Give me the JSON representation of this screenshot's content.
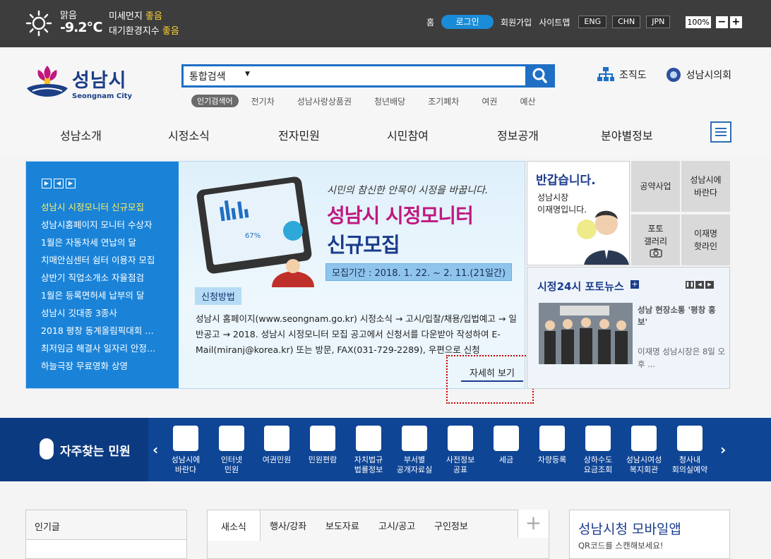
{
  "weather": {
    "condition": "맑음",
    "temp": "-9.2℃",
    "dust_label": "미세먼지",
    "dust_value": "좋음",
    "air_label": "대기환경지수",
    "air_value": "좋음"
  },
  "toplinks": {
    "home": "홈",
    "login": "로그인",
    "join": "회원가입",
    "sitemap": "사이트맵",
    "langs": [
      "ENG",
      "CHN",
      "JPN"
    ],
    "zoom": "100%",
    "zoom_out": "−",
    "zoom_in": "+"
  },
  "logo": {
    "name": "성남시",
    "sub": "Seongnam City"
  },
  "search": {
    "category": "통합검색",
    "arrow": "▼"
  },
  "keywords": {
    "label": "인기검색어",
    "items": [
      "전기차",
      "성남사랑상품권",
      "청년배당",
      "조기폐차",
      "여권",
      "예산"
    ]
  },
  "header_links": {
    "org": "조직도",
    "council": "성남시의회"
  },
  "gnb": [
    "성남소개",
    "시정소식",
    "전자민원",
    "시민참여",
    "정보공개",
    "분야별정보"
  ],
  "newslist": [
    "성남시 시정모니터 신규모집",
    "성남시홈페이지 모니터 수상자",
    "1월은 자동차세 연납의 달",
    "치매안심센터 쉼터 이용자 모집",
    "상반기 직업소개소 자율점검",
    "1월은 등록면허세 납부의 달",
    "성남시 깃대종 3종사",
    "2018 평창 동계올림픽대회 …",
    "최저임금 해결사 일자리 안정…",
    "하늘극장 무료영화 상영"
  ],
  "banner": {
    "slogan": "시민의 참신한 안목이 시정을 바꿉니다.",
    "title1": "성남시 시정모니터",
    "title2": "신규모집",
    "period": "모집기간 : 2018. 1. 22. ~ 2. 11.(21일간)",
    "method": "신청방법",
    "desc": "성남시 홈페이지(www.seongnam.go.kr) 시정소식 → 고시/입찰/채용/입법예고 → 일반공고 → 2018. 성남시 시정모니터 모집 공고에서 신청서를 다운받아 작성하여 E-Mail(miranj@korea.kr) 또는 방문, FAX(031-729-2289), 우편으로 신청",
    "more": "자세히 보기",
    "chart_pct": "67%"
  },
  "greet": {
    "title": "반갑습니다.",
    "line1": "성남시장",
    "line2": "이재명입니다."
  },
  "quick_boxes": [
    "공약사업",
    "성남시에 바란다",
    "포토 갤러리",
    "이재명 핫라인"
  ],
  "photonews": {
    "title": "시정24시 포토뉴스",
    "headline": "성남 현장소통 '평창 홍보'",
    "sub": "이재명 성남시장은 8일 오후 ..."
  },
  "band": {
    "title": "자주찾는 민원"
  },
  "services": [
    {
      "l1": "성남시에",
      "l2": "바란다"
    },
    {
      "l1": "인터넷",
      "l2": "민원"
    },
    {
      "l1": "여권민원",
      "l2": ""
    },
    {
      "l1": "민원편람",
      "l2": ""
    },
    {
      "l1": "자치법규",
      "l2": "법률정보"
    },
    {
      "l1": "부서별",
      "l2": "공개자료실"
    },
    {
      "l1": "사전정보",
      "l2": "공표"
    },
    {
      "l1": "세금",
      "l2": ""
    },
    {
      "l1": "차량등록",
      "l2": ""
    },
    {
      "l1": "상하수도",
      "l2": "요금조회"
    },
    {
      "l1": "성남시여성",
      "l2": "복지회관"
    },
    {
      "l1": "청사내",
      "l2": "회의실예약"
    }
  ],
  "popular": {
    "title": "인기글"
  },
  "tabs": [
    "새소식",
    "행사/강좌",
    "보도자료",
    "고시/공고",
    "구인정보"
  ],
  "mobile": {
    "title": "성남시청 모바일앱",
    "sub": "QR코드를 스캔해보세요!"
  },
  "colors": {
    "brand_blue": "#1f6fc5",
    "navy": "#1b3c8c",
    "magenta": "#c0187f",
    "band": "#0f4595",
    "good": "#ffd633"
  }
}
